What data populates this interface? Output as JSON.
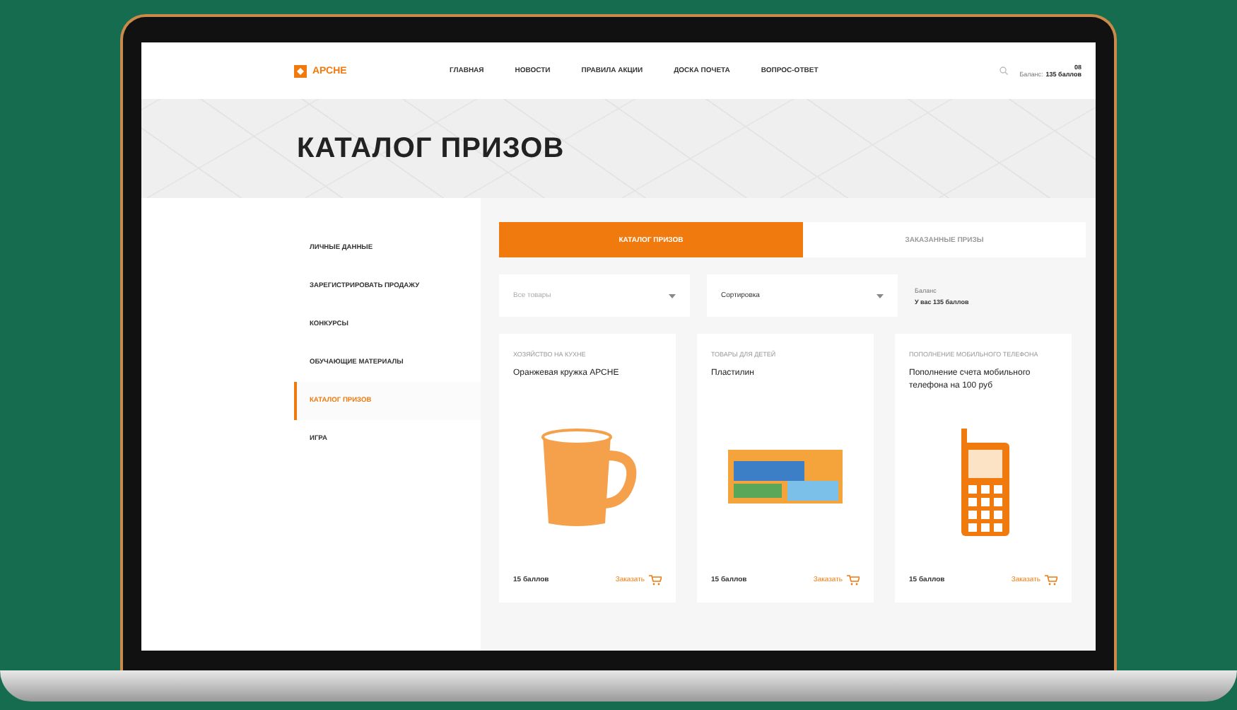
{
  "header": {
    "logo": "АРСНЕ",
    "nav": [
      "ГЛАВНАЯ",
      "НОВОСТИ",
      "ПРАВИЛА АКЦИИ",
      "ДОСКА ПОЧЕТА",
      "ВОПРОС-ОТВЕТ"
    ],
    "badge": "08",
    "balance_label": "Баланс:",
    "balance_value": "135 баллов"
  },
  "hero": {
    "title": "КАТАЛОГ ПРИЗОВ"
  },
  "sidebar": {
    "items": [
      {
        "label": "ЛИЧНЫЕ ДАННЫЕ",
        "selected": false
      },
      {
        "label": "ЗАРЕГИСТРИРОВАТЬ ПРОДАЖУ",
        "selected": false
      },
      {
        "label": "КОНКУРСЫ",
        "selected": false
      },
      {
        "label": "ОБУЧАЮЩИЕ МАТЕРИАЛЫ",
        "selected": false
      },
      {
        "label": "КАТАЛОГ ПРИЗОВ",
        "selected": true
      },
      {
        "label": "ИГРА",
        "selected": false
      }
    ]
  },
  "tabs": [
    {
      "label": "КАТАЛОГ ПРИЗОВ",
      "selected": true
    },
    {
      "label": "ЗАКАЗАННЫЕ ПРИЗЫ",
      "selected": false
    }
  ],
  "filters": [
    {
      "placeholder": "Все товары"
    },
    {
      "value": "Сортировка"
    }
  ],
  "balance": {
    "label": "Баланс",
    "value": "У вас 135 баллов"
  },
  "products": [
    {
      "kind": "mug",
      "category": "ХОЗЯЙСТВО НА КУХНЕ",
      "name": "Оранжевая кружка АРСНЕ",
      "price": "15 баллов",
      "action": "Заказать"
    },
    {
      "kind": "box",
      "category": "ТОВАРЫ ДЛЯ ДЕТЕЙ",
      "name": "Пластилин",
      "price": "15 баллов",
      "action": "Заказать"
    },
    {
      "kind": "phone",
      "category": "ПОПОЛНЕНИЕ МОБИЛЬНОГО ТЕЛЕФОНА",
      "name": "Пополнение счета мобильного телефона на 100 руб",
      "price": "15 баллов",
      "action": "Заказать"
    }
  ]
}
